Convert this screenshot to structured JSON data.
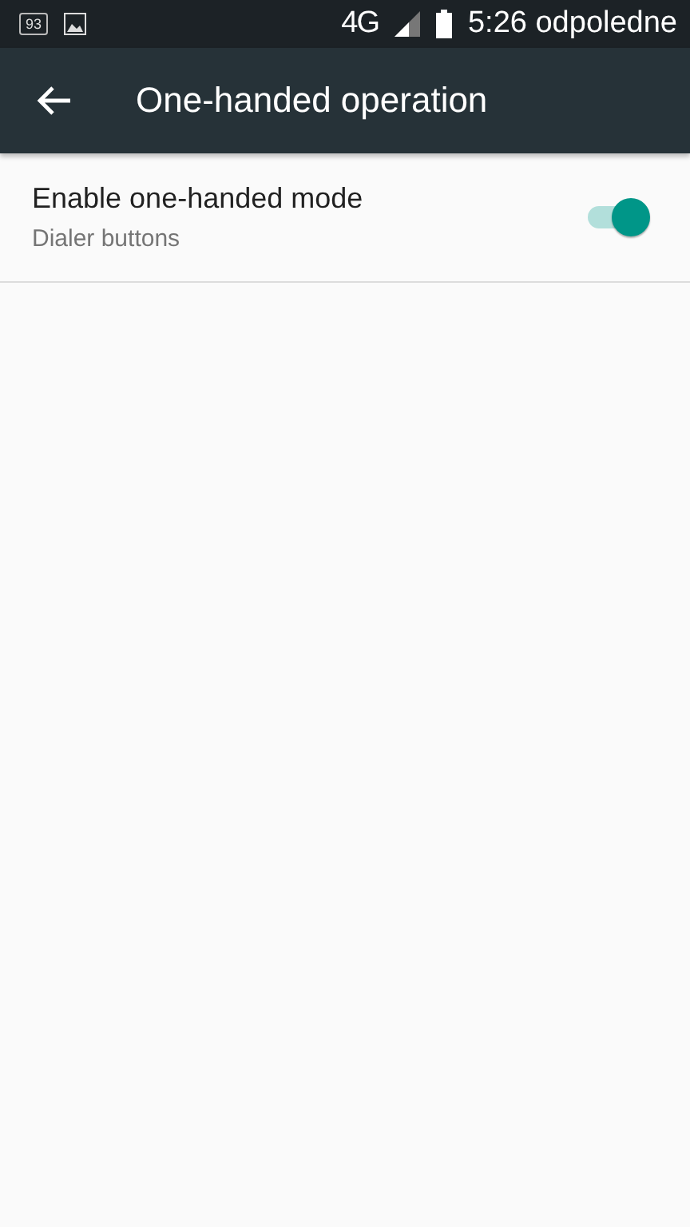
{
  "status_bar": {
    "notification_badge": "93",
    "network": "4G",
    "time": "5:26 odpoledne"
  },
  "app_bar": {
    "title": "One-handed operation"
  },
  "settings": [
    {
      "title": "Enable one-handed mode",
      "summary": "Dialer buttons",
      "on": true
    }
  ]
}
